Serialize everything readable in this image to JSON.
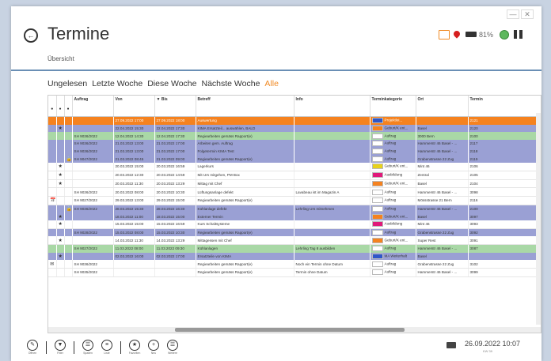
{
  "window": {
    "minimize": "—",
    "close": "✕"
  },
  "header": {
    "back_icon": "←",
    "title": "Termine",
    "breadcrumb": "Übersicht"
  },
  "status": {
    "battery_text": "81%",
    "wifi": "wifi-icon",
    "mail": "mail-icon",
    "pin": "location-pin-icon",
    "apps": "apps-icon"
  },
  "filters": [
    "Ungelesen",
    "Letzte Woche",
    "Diese Woche",
    "Nächste Woche",
    "Alle"
  ],
  "active_filter": 4,
  "table": {
    "columns": [
      "",
      "",
      "",
      "Auftrag",
      "Von",
      "▼ Bis",
      "Betreff",
      "Info",
      "Terminkategorie",
      "Ort",
      "Termin"
    ],
    "rows": [
      {
        "style": "orange",
        "c1": "",
        "c2": "",
        "c3": "",
        "auftrag": "",
        "von": "27.09.2022 17:00",
        "bis": "27.09.2022 18:00",
        "betreff": "Auswertung",
        "info": "",
        "cat": "Projektlei...",
        "catColor": "#2f56c9",
        "ort": "",
        "termin": "2121"
      },
      {
        "style": "purple",
        "c1": "",
        "c2": "★",
        "c3": "",
        "auftrag": "",
        "von": "22.04.2022 15:30",
        "bis": "22.04.2022 17:30",
        "betreff": "KIMA Ersatzteil... auswählen, BALD",
        "info": "",
        "cat": "Geburt/K ent...",
        "catColor": "#f5821f",
        "ort": "Basel",
        "termin": "2120"
      },
      {
        "style": "green",
        "c1": "",
        "c2": "",
        "c3": "",
        "auftrag": "SH 9036/2022",
        "von": "12.04.2022 14:30",
        "bis": "12.04.2022 17:30",
        "betreff": "Regiearbeiten gemäss Rapport(e)",
        "info": "",
        "cat": "Auftrag",
        "catColor": "#fff",
        "ort": "3000 Bern",
        "termin": "2100"
      },
      {
        "style": "purple",
        "c1": "",
        "c2": "",
        "c3": "",
        "auftrag": "SH 9036/2022",
        "von": "21.03.2022 13:00",
        "bis": "21.03.2022 17:00",
        "betreff": "Arbeiten gem. Auftrag",
        "info": "",
        "cat": "Auftrag",
        "catColor": "#fff",
        "ort": "Hammerstr 46 Basel - ...",
        "termin": "2117"
      },
      {
        "style": "purple",
        "c1": "",
        "c2": "",
        "c3": "",
        "auftrag": "SH 9036/2022",
        "von": "21.03.2022 13:00",
        "bis": "21.03.2022 17:00",
        "betreff": "Folgetermin KIMA Test",
        "info": "",
        "cat": "Auftrag",
        "catColor": "#fff",
        "ort": "Hammerstr 46 Basel - ...",
        "termin": "2118"
      },
      {
        "style": "purple",
        "c1": "",
        "c2": "",
        "c3": "🔒",
        "auftrag": "SH 9047/2022",
        "von": "21.03.2022 08:45",
        "bis": "21.03.2022 09:00",
        "betreff": "Regiearbeiten gemäss Rapport(e)",
        "info": "",
        "cat": "Auftrag",
        "catColor": "#fff",
        "ort": "Grabenstrasse 22 Zug",
        "termin": "2119"
      },
      {
        "style": "white",
        "c1": "",
        "c2": "★",
        "c3": "",
        "auftrag": "",
        "von": "20.03.2022 15:00",
        "bis": "20.03.2022 16:59",
        "betreff": "Lagerkurs",
        "info": "",
        "cat": "Geburt/K ent...",
        "catColor": "#e8d21a",
        "ort": "Mint 46",
        "termin": "2106"
      },
      {
        "style": "white",
        "c1": "",
        "c2": "★",
        "c3": "",
        "auftrag": "",
        "von": "20.03.2022 12:30",
        "bis": "20.03.2022 14:59",
        "betreff": "Mit Urs mitgehen, PM Box",
        "info": "",
        "cat": "Ausbildung",
        "catColor": "#e0197a",
        "ort": "Zentral",
        "termin": "2105"
      },
      {
        "style": "white",
        "c1": "",
        "c2": "★",
        "c3": "",
        "auftrag": "",
        "von": "20.03.2022 11:30",
        "bis": "20.03.2022 13:29",
        "betreff": "Mittag mit Chef",
        "info": "",
        "cat": "Geburt/K ent...",
        "catColor": "#f5821f",
        "ort": "Basel",
        "termin": "2104"
      },
      {
        "style": "white",
        "c1": "",
        "c2": "",
        "c3": "",
        "auftrag": "SH 9036/2022",
        "von": "20.03.2022 08:00",
        "bis": "20.03.2022 10:30",
        "betreff": "Lüftungsanlage defekt",
        "info": "Lavabeau ist im Magazin A",
        "cat": "Auftrag",
        "catColor": "#fff",
        "ort": "Hammerstr 46 Basel - ...",
        "termin": "3098"
      },
      {
        "style": "white",
        "c1": "📅",
        "c2": "",
        "c3": "",
        "auftrag": "SH 9027/2022",
        "von": "29.03.2022 13:00",
        "bis": "29.03.2022 15:00",
        "betreff": "Regiearbeiten gemäss Rapport(e)",
        "info": "",
        "cat": "Auftrag",
        "catColor": "#fff",
        "ort": "Mössstrasse 21 Bern",
        "termin": "2116"
      },
      {
        "style": "purple",
        "c1": "",
        "c2": "",
        "c3": "🔒",
        "auftrag": "SH 9036/2022",
        "von": "28.03.2022 15:30",
        "bis": "28.03.2022 16:30",
        "betreff": "Kühlanlage defekt",
        "info": "Lehrling Urs mitnehmen",
        "cat": "Auftrag",
        "catColor": "#fff",
        "ort": "Hammerstr 46 Basel - ...",
        "termin": "2100"
      },
      {
        "style": "purple",
        "c1": "",
        "c2": "★",
        "c3": "",
        "auftrag": "",
        "von": "18.03.2022 11:00",
        "bis": "18.03.2022 15:00",
        "betreff": "Externer Termin",
        "info": "",
        "cat": "Geburt/K ent...",
        "catColor": "#f5821f",
        "ort": "Basel",
        "termin": "3097"
      },
      {
        "style": "white",
        "c1": "",
        "c2": "★",
        "c3": "",
        "auftrag": "",
        "von": "15.03.2022 15:00",
        "bis": "15.03.2022 16:59",
        "betreff": "Kurs Schaltsysteme",
        "info": "",
        "cat": "Ausbildung",
        "catColor": "#e0197a",
        "ort": "Mint 46",
        "termin": "3093"
      },
      {
        "style": "purple",
        "c1": "",
        "c2": "",
        "c3": "",
        "auftrag": "SH 9028/2022",
        "von": "15.03.2022 08:00",
        "bis": "15.03.2022 10:30",
        "betreff": "Regiearbeiten gemäss Rapport(e)",
        "info": "",
        "cat": "Auftrag",
        "catColor": "#fff",
        "ort": "Grabenstrasse 22 Zug",
        "termin": "3092"
      },
      {
        "style": "white",
        "c1": "",
        "c2": "★",
        "c3": "",
        "auftrag": "",
        "von": "14.03.2022 11:30",
        "bis": "14.03.2022 13:29",
        "betreff": "Mittagessen mit Chef",
        "info": "",
        "cat": "Geburt/K ent...",
        "catColor": "#f5821f",
        "ort": "Super Rest",
        "termin": "3091"
      },
      {
        "style": "green",
        "c1": "",
        "c2": "",
        "c3": "",
        "auftrag": "SH 9027/2022",
        "von": "11.03.2022 08:00",
        "bis": "11.03.2022 09:30",
        "betreff": "Kühlanlagen",
        "info": "Lehrling Tag 8 ausbilden",
        "cat": "Auftrag",
        "catColor": "#fff",
        "ort": "Hammerstr 46 Basel - ...",
        "termin": "3087"
      },
      {
        "style": "purple",
        "c1": "",
        "c2": "★",
        "c3": "",
        "auftrag": "",
        "von": "02.03.2022 16:00",
        "bis": "02.03.2022 17:00",
        "betreff": "Ersatzteile von KIMA",
        "info": "",
        "cat": "MA Weiterhalt",
        "catColor": "#2f56c9",
        "ort": "Basel",
        "termin": ""
      },
      {
        "style": "white",
        "c1": "✉",
        "c2": "",
        "c3": "",
        "auftrag": "SH 9036/2022",
        "von": "",
        "bis": "",
        "betreff": "Regiearbeiten gemäss Rapport(e)",
        "info": "Noch ein Termin ohne Datum",
        "cat": "Auftrag",
        "catColor": "#fff",
        "ort": "Grabenstrasse 22 Zug",
        "termin": "3102"
      },
      {
        "style": "white",
        "c1": "",
        "c2": "",
        "c3": "",
        "auftrag": "SH 9035/2022",
        "von": "",
        "bis": "",
        "betreff": "Regiearbeiten gemäss Rapport(e)",
        "info": "Termin ohne Datum",
        "cat": "Auftrag",
        "catColor": "#fff",
        "ort": "Hammerstr 46 Basel - ...",
        "termin": "3099"
      }
    ]
  },
  "toolbar": [
    {
      "icon": "edit-icon",
      "glyph": "✎",
      "label": "Öffnen"
    },
    {
      "sep": true
    },
    {
      "icon": "filter-icon",
      "glyph": "▼",
      "label": "Filter"
    },
    {
      "sep": true
    },
    {
      "icon": "list-icon",
      "glyph": "☰",
      "label": "Spalten"
    },
    {
      "icon": "list2-icon",
      "glyph": "≡",
      "label": "Liste"
    },
    {
      "sep": true
    },
    {
      "icon": "star-icon",
      "glyph": "★",
      "label": "Favoriten"
    },
    {
      "icon": "add-icon",
      "glyph": "+",
      "label": "Neu"
    },
    {
      "icon": "menu-icon",
      "glyph": "☰",
      "label": "Weitere"
    }
  ],
  "datetime": "26.09.2022 10:07",
  "datetime_sub": "KW 39"
}
